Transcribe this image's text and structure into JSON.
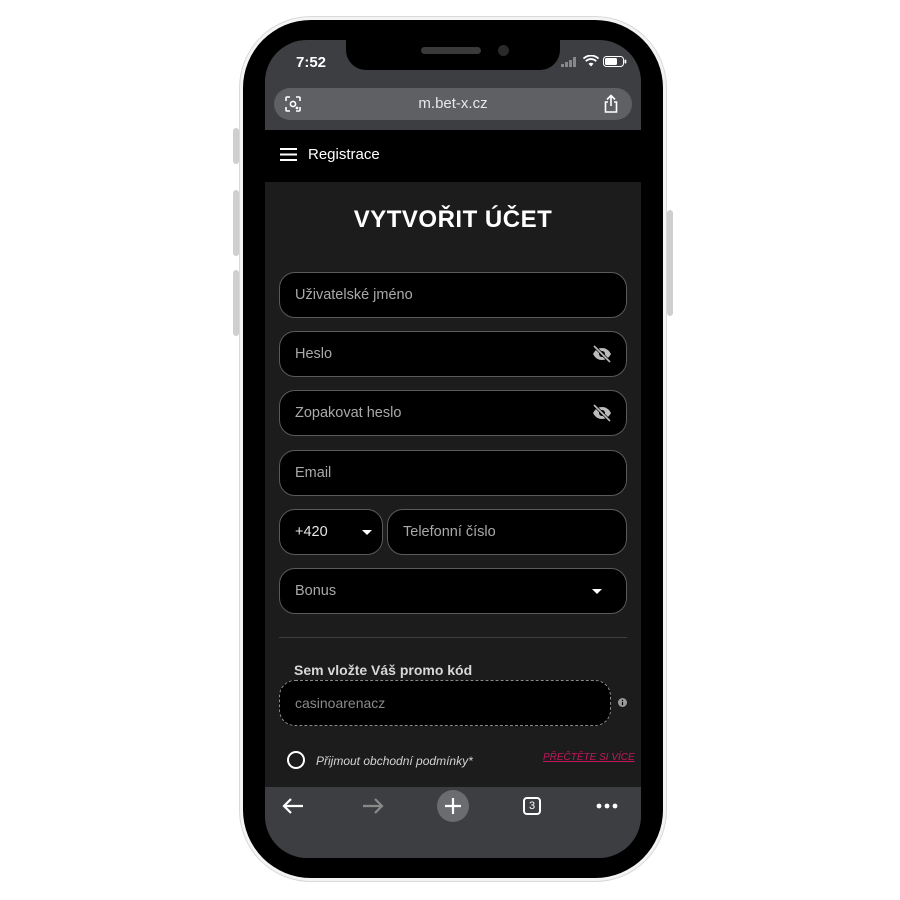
{
  "status_bar": {
    "time": "7:52"
  },
  "browser": {
    "url": "m.bet-x.cz",
    "tab_count": "3"
  },
  "header": {
    "title": "Registrace"
  },
  "form": {
    "title": "VYTVOŘIT ÚČET",
    "username_placeholder": "Uživatelské jméno",
    "password_placeholder": "Heslo",
    "repeat_password_placeholder": "Zopakovat heslo",
    "email_placeholder": "Email",
    "phone_prefix": "+420",
    "phone_placeholder": "Telefonní číslo",
    "bonus_label": "Bonus",
    "promo_label": "Sem vložte Váš promo kód",
    "promo_value": "casinoarenacz",
    "terms_label": "Přijmout obchodní podmínky*",
    "read_more": "PŘEČTĚTE SI VÍCE"
  },
  "colors": {
    "background": "#1c1c1c",
    "field_bg": "#000000",
    "link": "#c2185b",
    "browser_chrome": "#3c3e41"
  },
  "icons": [
    "lens-icon",
    "share-icon",
    "hamburger-icon",
    "eye-off-icon",
    "chevron-down-icon",
    "info-icon",
    "back-arrow-icon",
    "forward-arrow-icon",
    "plus-icon",
    "tabs-icon",
    "more-icon"
  ]
}
